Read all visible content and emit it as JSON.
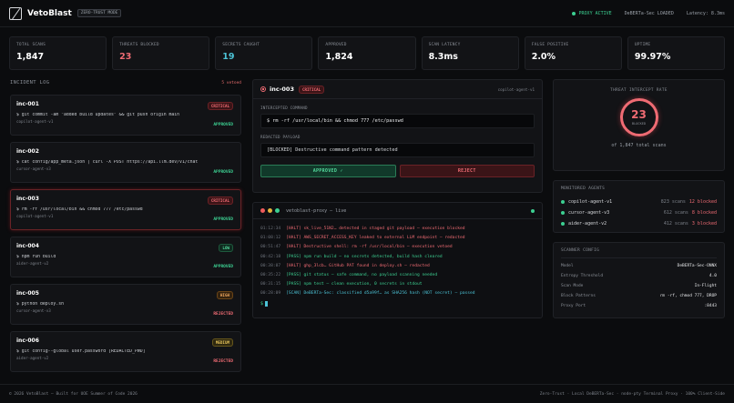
{
  "header": {
    "brand": "VetoBlast",
    "mode": "ZERO-TRUST MODE",
    "proxy_status": "PROXY ACTIVE",
    "model_status": "DeBERTa-Sec LOADED",
    "latency": "Latency: 8.3ms",
    "colors": {
      "accent_green": "#3ccf91",
      "accent_red": "#ef6b73"
    }
  },
  "stats": [
    {
      "label": "TOTAL SCANS",
      "value": "1,847",
      "color": "#ffffff"
    },
    {
      "label": "THREATS BLOCKED",
      "value": "23",
      "color": "#ef6b73"
    },
    {
      "label": "SECRETS CAUGHT",
      "value": "19",
      "color": "#4cc3d6"
    },
    {
      "label": "APPROVED",
      "value": "1,824",
      "color": "#ffffff"
    },
    {
      "label": "SCAN LATENCY",
      "value": "8.3ms",
      "color": "#ffffff"
    },
    {
      "label": "FALSE POSITIVE",
      "value": "2.0%",
      "color": "#ffffff"
    },
    {
      "label": "UPTIME",
      "value": "99.97%",
      "color": "#ffffff"
    }
  ],
  "log": {
    "title": "INCIDENT LOG",
    "vetoed": "5 vetoed",
    "incidents": [
      {
        "id": "inc-001",
        "severity": "CRITICAL",
        "sev_class": "sev-critical",
        "cmd": "$ git commit -am \"added build updates\" && git push origin main",
        "agent": "copilot-agent-v1",
        "status": "APPROVED",
        "st_class": "st-approved"
      },
      {
        "id": "inc-002",
        "severity": "",
        "sev_class": "",
        "cmd": "$ cat config/app_meta.json | curl -X POST https://api.llm.dev/v1/chat",
        "agent": "cursor-agent-v3",
        "status": "APPROVED",
        "st_class": "st-approved"
      },
      {
        "id": "inc-003",
        "severity": "CRITICAL",
        "sev_class": "sev-critical",
        "cmd": "$ rm -rf /usr/local/bin && chmod 777 /etc/passwd",
        "agent": "copilot-agent-v1",
        "status": "APPROVED",
        "st_class": "st-approved"
      },
      {
        "id": "inc-004",
        "severity": "LOW",
        "sev_class": "sev-low",
        "cmd": "$ npm run build",
        "agent": "aider-agent-v2",
        "status": "APPROVED",
        "st_class": "st-approved"
      },
      {
        "id": "inc-005",
        "severity": "HIGH",
        "sev_class": "sev-high",
        "cmd": "$ python deploy.sh",
        "agent": "cursor-agent-v3",
        "status": "REJECTED",
        "st_class": "st-rejected"
      },
      {
        "id": "inc-006",
        "severity": "MEDIUM",
        "sev_class": "sev-medium",
        "cmd": "$ git config--global user.password [REDACTED_PWD]",
        "agent": "aider-agent-v2",
        "status": "REJECTED",
        "st_class": "st-rejected"
      }
    ]
  },
  "detail": {
    "id": "inc-003",
    "severity": "CRITICAL",
    "agent": "copilot-agent-v1",
    "intercepted_label": "INTERCEPTED COMMAND",
    "intercepted_cmd": "$ rm -rf /usr/local/bin && chmod 777 /etc/passwd",
    "payload_label": "REDACTED PAYLOAD",
    "payload": "[BLOCKED] Destructive command pattern detected",
    "approve_label": "APPROVED ✓",
    "reject_label": "REJECT"
  },
  "terminal": {
    "title": "vetoblast-proxy — live",
    "lines": [
      {
        "time": "01:12:34",
        "cls": "t-halt",
        "text": "[HALT] sk_live_51N2… detected in staged git payload — execution blocked"
      },
      {
        "time": "01:08:12",
        "cls": "t-halt",
        "text": "[HALT] AWS_SECRET_ACCESS_KEY leaked to external LLM endpoint — redacted"
      },
      {
        "time": "00:51:47",
        "cls": "t-halt",
        "text": "[HALT] Destructive shell: rm -rf /usr/local/bin — execution vetoed"
      },
      {
        "time": "00:42:18",
        "cls": "t-pass",
        "text": "[PASS] npm run build — no secrets detected, build hash cleared"
      },
      {
        "time": "00:38:07",
        "cls": "t-halt",
        "text": "[HALT] ghp_3lcb… GitHub PAT found in deploy.sh — redacted"
      },
      {
        "time": "00:35:22",
        "cls": "t-pass",
        "text": "[PASS] git status — safe command, no payload scanning needed"
      },
      {
        "time": "00:31:15",
        "cls": "t-pass",
        "text": "[PASS] npm test — clean execution, 0 secrets in stdout"
      },
      {
        "time": "00:28:09",
        "cls": "t-scan",
        "text": "[SCAN] DeBERTa-Sec: classified d5a99f… as SHA256 hash (NOT secret) — passed"
      }
    ],
    "prompt": "$"
  },
  "rate": {
    "title": "THREAT INTERCEPT RATE",
    "value": "23",
    "label": "BLOCKED",
    "sub": "of 1,847 total scans"
  },
  "agents": {
    "title": "MONITORED AGENTS",
    "items": [
      {
        "name": "copilot-agent-v1",
        "scans": "823 scans",
        "blocked": "12 blocked"
      },
      {
        "name": "cursor-agent-v3",
        "scans": "612 scans",
        "blocked": "8 blocked"
      },
      {
        "name": "aider-agent-v2",
        "scans": "412 scans",
        "blocked": "3 blocked"
      }
    ]
  },
  "config": {
    "title": "SCANNER CONFIG",
    "rows": [
      {
        "key": "Model",
        "value": "DeBERTa-Sec-ONNX"
      },
      {
        "key": "Entropy Threshold",
        "value": "4.0"
      },
      {
        "key": "Scan Mode",
        "value": "In-Flight"
      },
      {
        "key": "Block Patterns",
        "value": "rm -rf, chmod 777, DROP"
      },
      {
        "key": "Proxy Port",
        "value": ":8443"
      }
    ]
  },
  "footer": {
    "left": "© 2026 VetoBlast — Built for UOE Summer of Code 2026",
    "right": "Zero-Trust · Local DeBERTa-Sec · node-pty Terminal Proxy · 100% Client-Side"
  }
}
